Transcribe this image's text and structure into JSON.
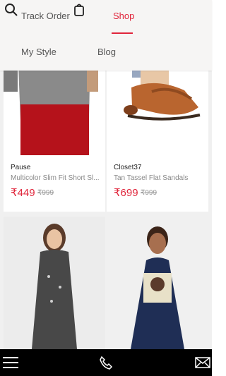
{
  "header": {
    "nav": {
      "track_order": "Track Order",
      "shop": "Shop",
      "my_style": "My Style",
      "blog": "Blog"
    },
    "icons": [
      "search-icon",
      "shopping-bag-icon"
    ],
    "accent_color": "#e0243a"
  },
  "products": [
    {
      "brand": "Pause",
      "title": "Multicolor Slim Fit Short Sl...",
      "price": "₹449",
      "mrp": "₹999",
      "image": "tshirt-image"
    },
    {
      "brand": "Closet37",
      "title": "Tan Tassel Flat Sandals",
      "price": "₹699",
      "mrp": "₹999",
      "image": "sandals-image"
    },
    {
      "image": "dress-image"
    },
    {
      "image": "graphic-tshirt-image"
    }
  ],
  "bottom_bar": {
    "icons": [
      "menu-icon",
      "phone-icon",
      "mail-icon"
    ]
  }
}
